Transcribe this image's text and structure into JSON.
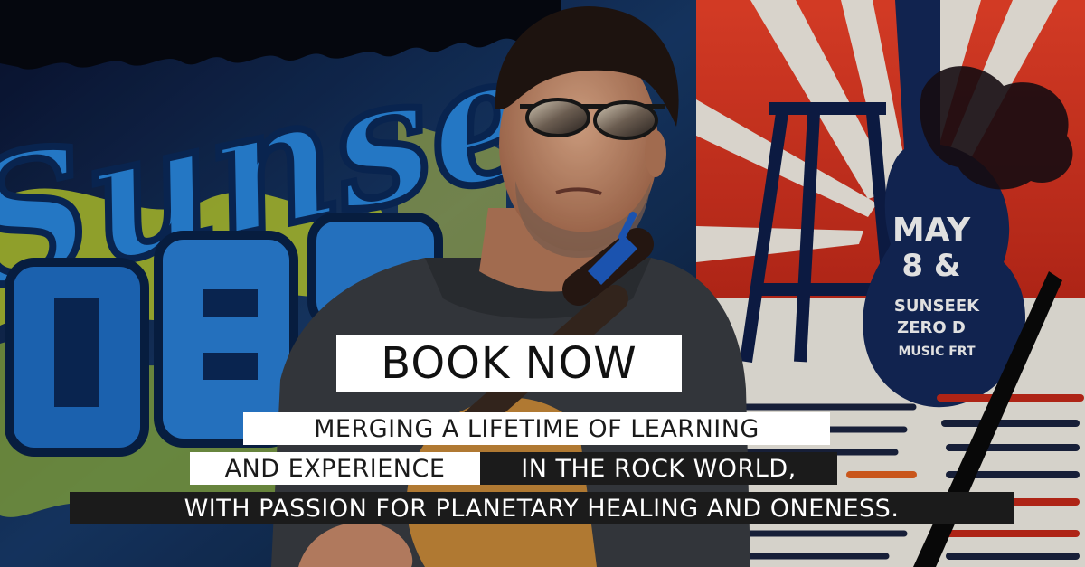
{
  "banner": {
    "cta": "BOOK NOW",
    "tagline": {
      "line1": "MERGING A LIFETIME OF LEARNING",
      "line2_light": "AND EXPERIENCE",
      "line2_dark": "IN THE ROCK WORLD,",
      "line3": "WITH PASSION FOR PLANETARY HEALING AND ONENESS."
    }
  },
  "background_photo": {
    "mural_word": "Sunset",
    "poster_text": {
      "date": "MAY",
      "date2": "8 &",
      "event1": "SUNSEEK",
      "event2": "ZERO D",
      "event3": "MUSIC FRT"
    }
  },
  "colors": {
    "cta_background": "#ffffff",
    "cta_text": "#111111",
    "dark_band": "#1b1b1b",
    "mural_blue": "#1f6fc7",
    "poster_red": "#e5321f"
  }
}
